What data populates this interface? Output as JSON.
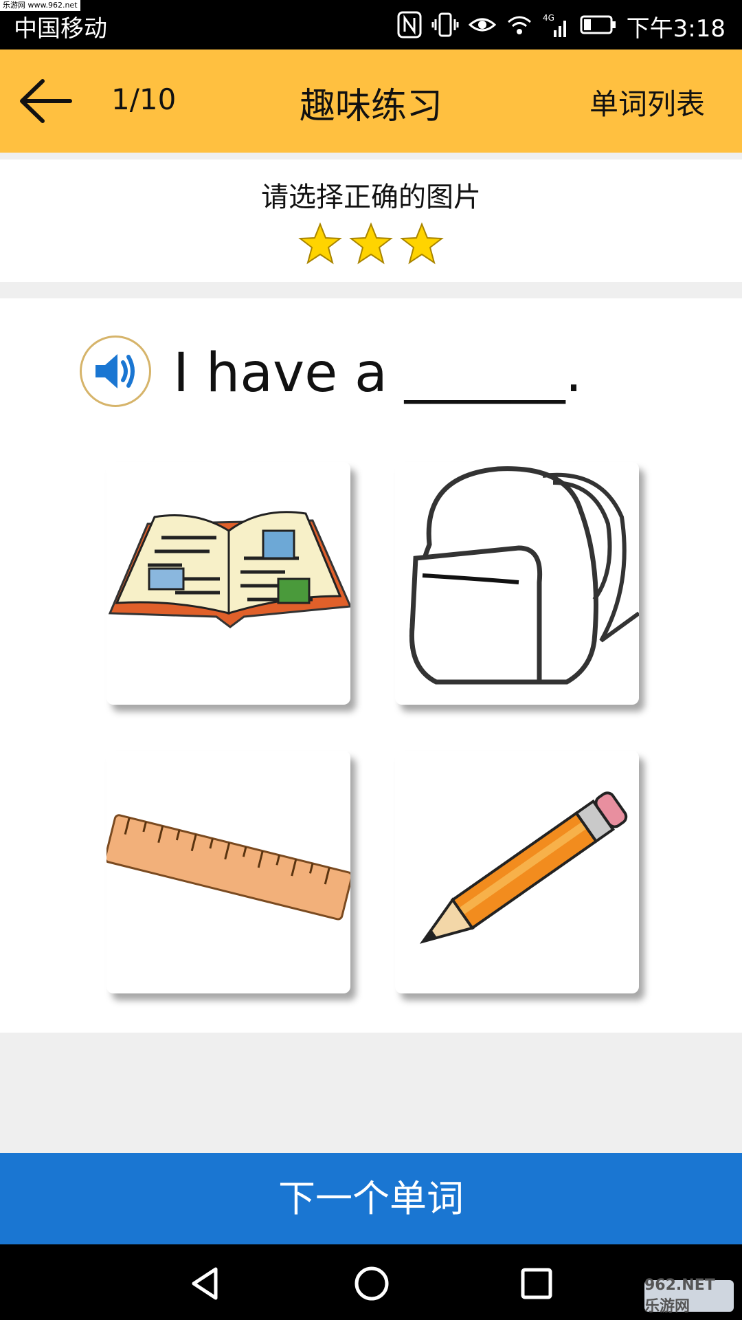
{
  "status_bar": {
    "carrier": "中国移动",
    "time": "下午3:18",
    "watermark": "乐游网 www.962.net",
    "network": "4G",
    "icons": [
      "nfc-icon",
      "vibrate-icon",
      "eye-icon",
      "wifi-icon",
      "signal-icon",
      "battery-icon"
    ]
  },
  "app_bar": {
    "counter": "1/10",
    "title": "趣味练习",
    "word_list": "单词列表",
    "back_icon": "arrow-left-icon",
    "color": "#ffc040"
  },
  "instruction": {
    "text": "请选择正确的图片",
    "stars": 3
  },
  "question": {
    "sentence": "I have a ______.",
    "speaker_icon": "speaker-icon"
  },
  "options": [
    {
      "name": "book",
      "icon": "open-book-image"
    },
    {
      "name": "backpack",
      "icon": "backpack-image"
    },
    {
      "name": "ruler",
      "icon": "ruler-image"
    },
    {
      "name": "pencil",
      "icon": "pencil-image"
    }
  ],
  "next_button": {
    "label": "下一个单词",
    "color": "#1a76d2"
  },
  "nav_bar": {
    "icons": [
      "back-triangle-icon",
      "home-circle-icon",
      "recents-square-icon"
    ],
    "watermark": "962.NET 乐游网"
  }
}
